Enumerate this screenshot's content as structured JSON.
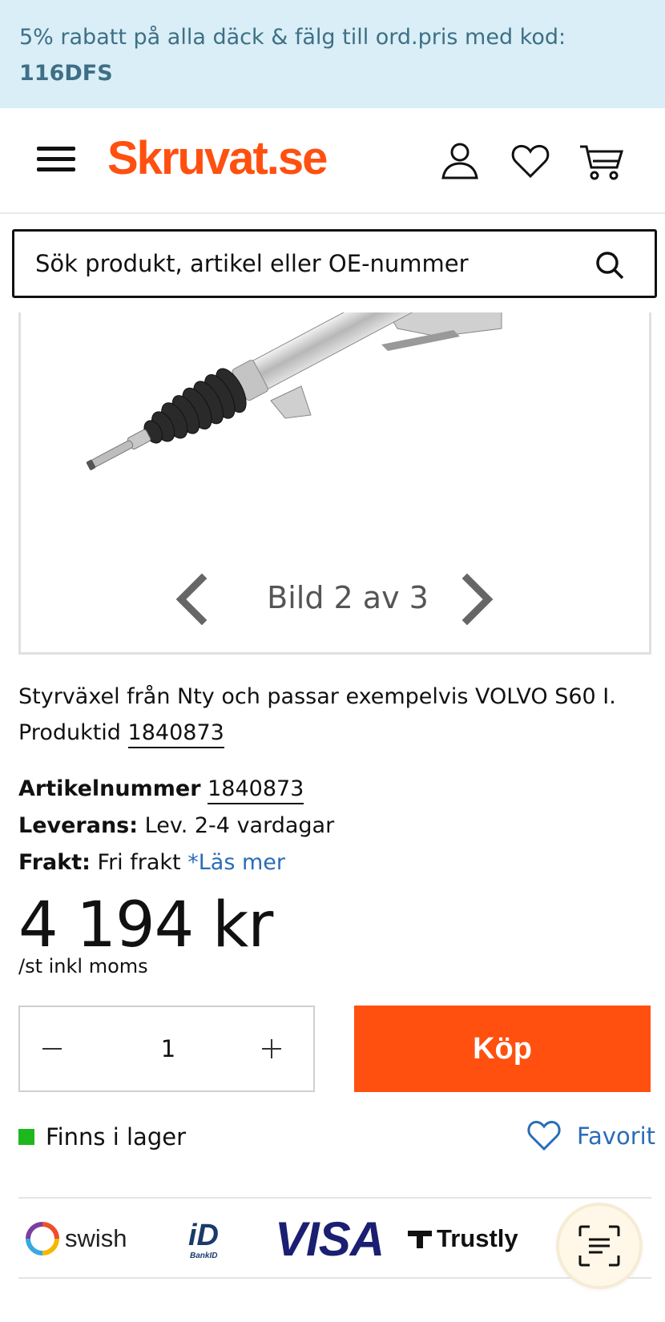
{
  "promo": {
    "text": "5% rabatt på alla däck & fälg till ord.pris med kod:",
    "code": "116DFS"
  },
  "header": {
    "logo": "Skruvat.se",
    "icons": [
      "menu-icon",
      "user-icon",
      "heart-icon",
      "cart-icon"
    ]
  },
  "search": {
    "placeholder": "Sök produkt, artikel eller OE-nummer",
    "icon": "search-icon"
  },
  "gallery": {
    "counter": "Bild 2 av 3"
  },
  "product": {
    "description": "Styrväxel från Nty och passar exempelvis VOLVO S60 I.",
    "produktid_label": "Produktid",
    "produktid": "1840873",
    "artikelnummer_label": "Artikelnummer",
    "artikelnummer": "1840873",
    "leverans_label": "Leverans:",
    "leverans": "Lev. 2-4 vardagar",
    "frakt_label": "Frakt:",
    "frakt": "Fri frakt",
    "frakt_link": "*Läs mer",
    "price": "4 194 kr",
    "price_sub": "/st inkl moms"
  },
  "purchase": {
    "quantity": "1",
    "buy_label": "Köp",
    "stock": "Finns i lager",
    "favorite": "Favorit"
  },
  "payments": {
    "swish": "swish",
    "bankid": "BankID",
    "visa": "VISA",
    "trustly": "Trustly"
  },
  "colors": {
    "brand": "#ff5010",
    "promo_bg": "#d9eef6",
    "link": "#2a6cb7",
    "stock_green": "#1cb81c"
  }
}
